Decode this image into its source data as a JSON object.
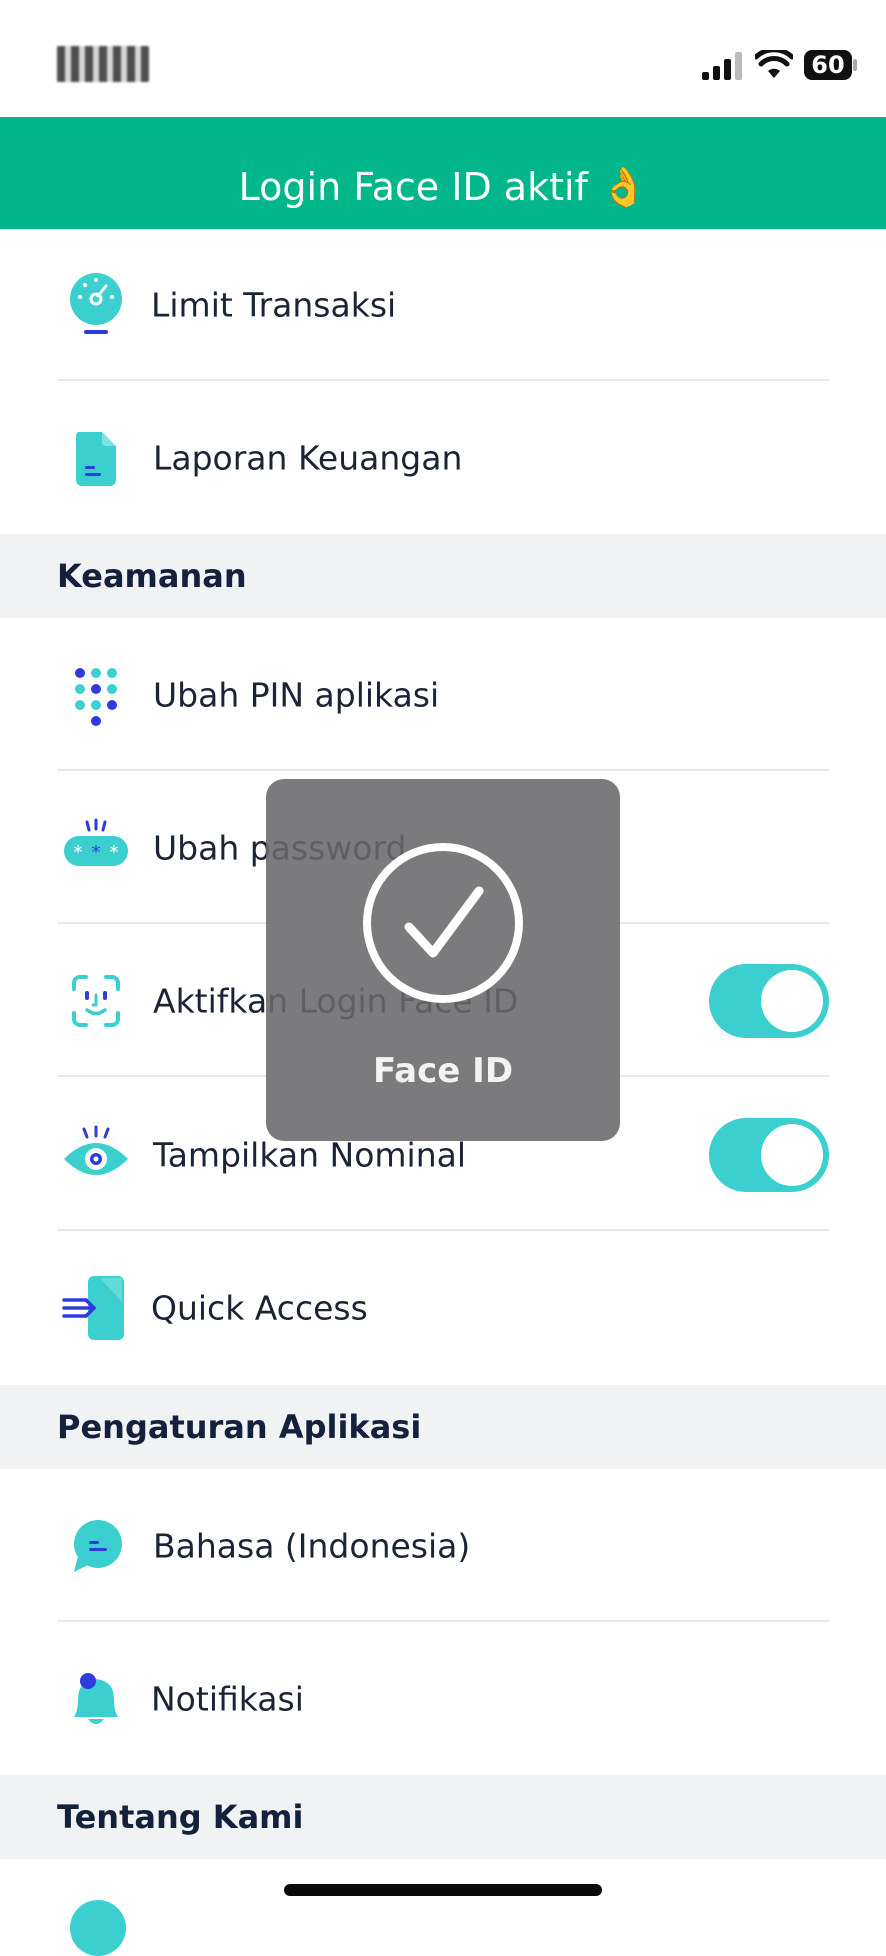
{
  "status_bar": {
    "battery": "60"
  },
  "toast": {
    "text": "Login Face ID aktif 👌"
  },
  "rows_top": [
    {
      "label": "Limit Transaksi",
      "icon": "speedometer-icon"
    },
    {
      "label": "Laporan Keuangan",
      "icon": "document-icon"
    }
  ],
  "security": {
    "title": "Keamanan",
    "items": [
      {
        "label": "Ubah PIN aplikasi",
        "icon": "pin-dots-icon"
      },
      {
        "label": "Ubah password",
        "icon": "password-icon"
      },
      {
        "label": "Aktifkan Login Face ID",
        "icon": "face-id-icon",
        "toggle_on": true
      },
      {
        "label": "Tampilkan Nominal",
        "icon": "eye-icon",
        "toggle_on": true
      },
      {
        "label": "Quick Access",
        "icon": "quick-access-icon"
      }
    ]
  },
  "app_settings": {
    "title": "Pengaturan Aplikasi",
    "items": [
      {
        "label": "Bahasa (Indonesia)",
        "icon": "chat-bubble-icon"
      },
      {
        "label": "Notifikasi",
        "icon": "bell-icon"
      }
    ]
  },
  "about": {
    "title": "Tentang Kami"
  },
  "faceid_hud": {
    "label": "Face ID"
  },
  "colors": {
    "toast_bg": "#00b68a",
    "accent": "#3ccfcf",
    "icon_blue": "#2f3bdb"
  }
}
